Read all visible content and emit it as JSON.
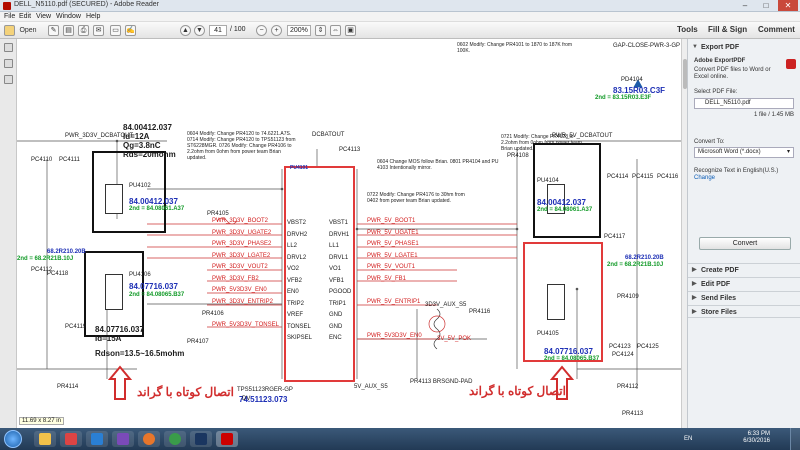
{
  "window": {
    "title": "DELL_N5110.pdf (SECURED) - Adobe Reader",
    "min": "–",
    "max": "□",
    "close": "✕"
  },
  "menu": {
    "file": "File",
    "edit": "Edit",
    "view": "View",
    "window": "Window",
    "help": "Help"
  },
  "toolbar": {
    "open": "Open",
    "page_current": "41",
    "page_total": "/ 100",
    "zoom": "200%",
    "tools": "Tools",
    "fill_sign": "Fill & Sign",
    "comment": "Comment"
  },
  "right_panel": {
    "export_pdf": "Export PDF",
    "adobe_export": "Adobe ExportPDF",
    "export_desc": "Convert PDF files to Word or Excel online.",
    "select_pdf": "Select PDF File:",
    "file_name": "DELL_N5110.pdf",
    "file_info": "1 file / 1.45 MB",
    "convert_to": "Convert To:",
    "convert_value": "Microsoft Word (*.docx)",
    "recognize": "Recognize Text in English(U.S.)",
    "change": "Change",
    "convert_btn": "Convert",
    "create_pdf": "Create PDF",
    "edit_pdf": "Edit PDF",
    "send_files": "Send Files",
    "store_files": "Store Files"
  },
  "schematic": {
    "part1": "84.00412.037",
    "id1": "Id=12A",
    "qg": "Qg=3.8nC",
    "rds": "Rds=20mohm",
    "pu4102": "PU4102",
    "p2": "84.00412.037",
    "p2b": "2nd = 84.08061.A37",
    "pu4106": "PU4106",
    "p3": "84.07716.037",
    "p3b": "2nd = 84.08065.B37",
    "p4": "84.07716.037",
    "id4": "Id=15A",
    "rdson": "Rdson=13.5~16.5mohm",
    "ic": "PU4101",
    "ic_part": "TPS51123RGER-GP",
    "ic_num": "74.51123.073",
    "dcbatout": "DCBATOUT",
    "pwr_left": "PWR_3D3V_DCBATOUT",
    "pwr_right": "PWR_5V_DCBATOUT",
    "right_p1": "84.00412.037",
    "right_p1b": "2nd = 84.08061.A37",
    "right_p2": "84.07716.037",
    "right_p2b": "2nd = 84.08065.B37",
    "pu4104": "PU4104",
    "pu4105": "PU4105",
    "topright": "83.15R03.C3F",
    "topright2": "2nd = 83.15R03.E3F",
    "diode": "PD4104",
    "gap": "GAP-CLOSE-PWR-3-GP",
    "pc4121": "68.2R210.20B",
    "pc4121b": "2nd = 68.2R21B.10J",
    "pc4122": "68.2R210.20B",
    "pc4122b": "2nd = 68.2R21B.10J",
    "arabic_left": "اتصال کوتاه با گراند",
    "arabic_right": "اتصال کوتاه با گراند",
    "dv": "DV",
    "pins_left": [
      "VBST2",
      "DRVH2",
      "LL2",
      "DRVL2",
      "VO2",
      "VFB2",
      "EN0",
      "TRIP2",
      "VREF",
      "TONSEL",
      "SKIPSEL"
    ],
    "pins_right": [
      "VBST1",
      "DRVH1",
      "LL1",
      "DRVL1",
      "VO1",
      "VFB1",
      "PGOOD",
      "TRIP1",
      "GND",
      "GND",
      "ENC"
    ],
    "nets_left": [
      "PWR_3D3V_BOOT2",
      "PWR_3D3V_UGATE2",
      "PWR_3D3V_PHASE2",
      "PWR_3D3V_LGATE2",
      "PWR_3D3V_VOUT2",
      "PWR_3D3V_FB2",
      "PWR_5V3D3V_EN0",
      "PWR_3D3V_ENTRIP2",
      "",
      "PWR_5V3D3V_TONSEL",
      ""
    ],
    "nets_right": [
      "PWR_5V_BOOT1",
      "PWR_5V_UGATE1",
      "PWR_5V_PHASE1",
      "PWR_5V_LGATE1",
      "PWR_5V_VOUT1",
      "PWR_5V_FB1",
      "",
      "PWR_5V_ENTRIP1",
      "",
      "",
      "PWR_5V3D3V_EN0"
    ],
    "v_aux": "3D3V_AUX_S5",
    "pr": "PR4116",
    "pcpok": "3V_5V_POK",
    "note1": "0604 Modify: Change PR4120 to 74.6221.A7S. 0714 Modify: Change PR4120 to TPS51123 from ST6228MGR. 0726 Modify: Change PR4106 to 2.2ohm from 0ohm from power team Brian updated.",
    "note2": "0721 Modify: Change PR4128 to 2.2ohm from 0ohm from power team Brian updated.",
    "note3": "0604 Change MOS follow Brian. 0801 PR4104 and PU 4103 Intentionally mirror.",
    "note4": "0722 Modify: Change PR4176 to 30hm from 0402 from power team Brian updated.",
    "topnote": "0602 Modify: Change PR4101 to 1870 to 187K from 100K.",
    "pc_labels": [
      "PC4110",
      "PC4111",
      "PC4112",
      "PC4113",
      "PC4114",
      "PC4115",
      "PC4116",
      "PC4117",
      "PC4118",
      "PC4119",
      "PC4123",
      "PC4124",
      "PC4125"
    ],
    "pr_labels": [
      "PR4105",
      "PR4106",
      "PR4107",
      "PR4108",
      "PR4109",
      "PR4112",
      "PR4113",
      "PR4114"
    ],
    "gnd_small": "5V_AUX_S5",
    "pr_pad": "PR4113 BRSGND-PAD",
    "size": "11.69 x 8.27 in"
  },
  "taskbar": {
    "time": "6:33 PM",
    "date": "6/30/2016",
    "lang": "EN"
  }
}
